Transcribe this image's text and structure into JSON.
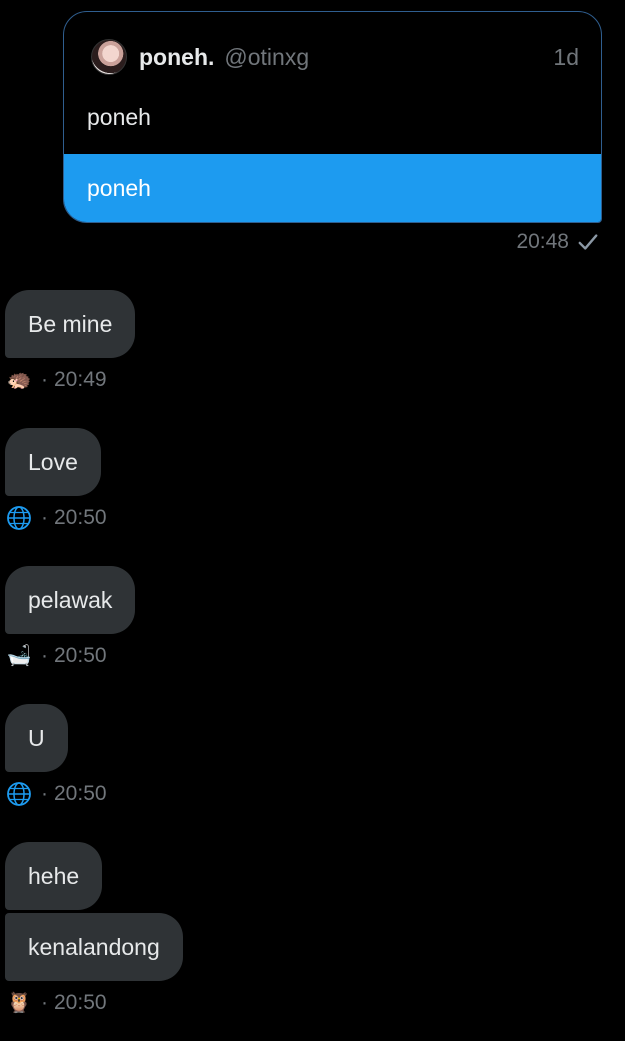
{
  "sent_message": {
    "quote": {
      "display_name": "poneh.",
      "handle": "@otinxg",
      "age": "1d",
      "text": "poneh"
    },
    "text": "poneh",
    "time": "20:48",
    "status_icon": "check-icon"
  },
  "received_messages": [
    {
      "text": "Be mine",
      "emoji_icon": "hedgehog-icon",
      "time": "20:49"
    },
    {
      "text": "Love",
      "emoji_icon": "globe-icon",
      "time": "20:50"
    },
    {
      "text": "pelawak",
      "emoji_icon": "bathtub-icon",
      "time": "20:50"
    },
    {
      "text": "U",
      "emoji_icon": "globe-icon",
      "time": "20:50"
    },
    {
      "text": "hehe",
      "emoji_icon": "owl-icon",
      "time": ""
    },
    {
      "text": "kenalandong",
      "emoji_icon": "owl-icon",
      "time": "20:50"
    }
  ],
  "separator": "·",
  "colors": {
    "background": "#000000",
    "sent_bubble": "#1d9bf0",
    "received_bubble": "#2f3336",
    "muted_text": "#71767b"
  }
}
